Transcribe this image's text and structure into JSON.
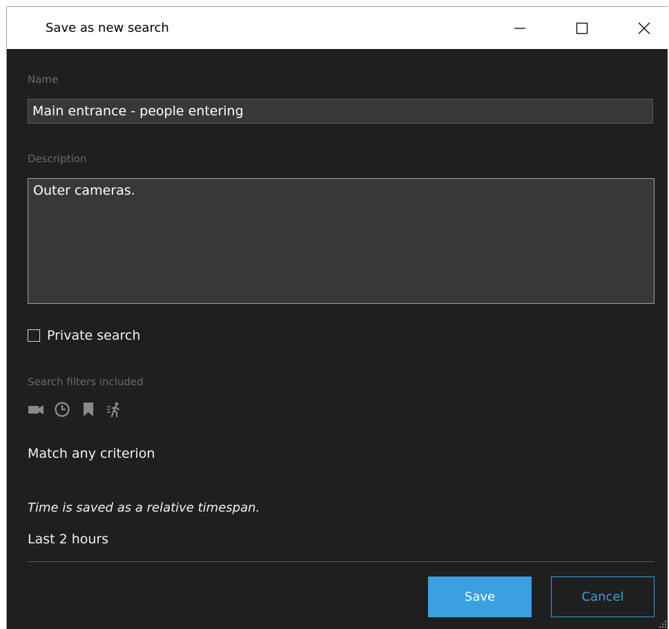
{
  "window": {
    "title": "Save as new search",
    "minimize_icon": "minimize-icon",
    "maximize_icon": "maximize-icon",
    "close_icon": "close-icon"
  },
  "form": {
    "name_label": "Name",
    "name_value": "Main entrance - people entering",
    "description_label": "Description",
    "description_value": "Outer cameras.",
    "private_label": "Private search",
    "private_checked": false
  },
  "filters": {
    "label": "Search filters included",
    "icons": [
      "camera-icon",
      "clock-icon",
      "bookmark-icon",
      "motion-person-icon"
    ],
    "match_text": "Match any criterion"
  },
  "time": {
    "note": "Time is saved as a relative timespan.",
    "value": "Last 2 hours"
  },
  "buttons": {
    "save_label": "Save",
    "cancel_label": "Cancel"
  },
  "colors": {
    "accent": "#3aa0e1",
    "background": "#1f1f1f",
    "input_background": "#383838"
  }
}
